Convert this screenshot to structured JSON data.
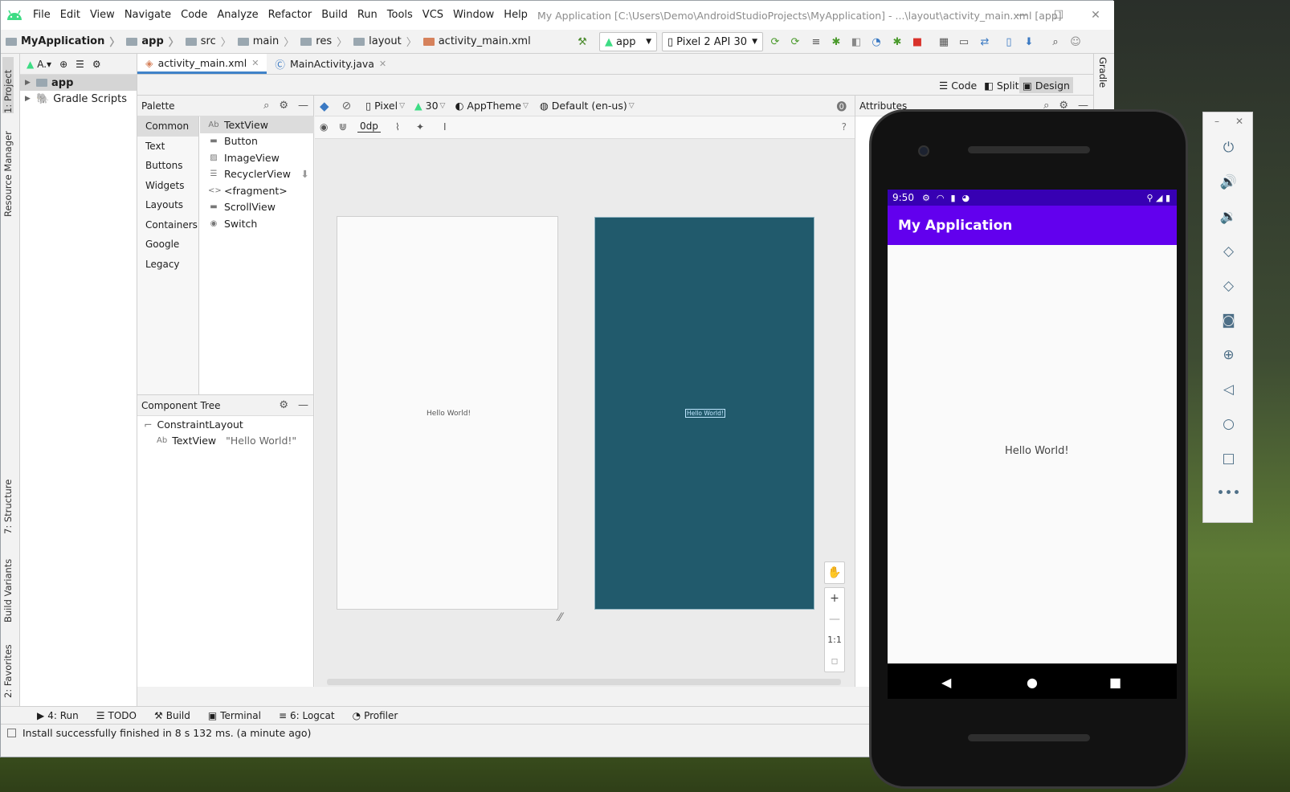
{
  "menu": [
    "File",
    "Edit",
    "View",
    "Navigate",
    "Code",
    "Analyze",
    "Refactor",
    "Build",
    "Run",
    "Tools",
    "VCS",
    "Window",
    "Help"
  ],
  "window_title": "My Application [C:\\Users\\Demo\\AndroidStudioProjects\\MyApplication] - ...\\layout\\activity_main.xml [app]",
  "breadcrumbs": [
    "MyApplication",
    "app",
    "src",
    "main",
    "res",
    "layout",
    "activity_main.xml"
  ],
  "run_config": "app",
  "device_selector": "Pixel 2 API 30",
  "left_stripe": {
    "project": "1: Project",
    "resource_manager": "Resource Manager",
    "structure": "7: Structure",
    "build_variants": "Build Variants",
    "favorites": "2: Favorites"
  },
  "project_tree": {
    "toolbar_label": "A.▾",
    "items": [
      "app",
      "Gradle Scripts"
    ]
  },
  "editor_tabs": [
    "activity_main.xml",
    "MainActivity.java"
  ],
  "view_modes": [
    "Code",
    "Split",
    "Design"
  ],
  "palette": {
    "title": "Palette",
    "categories": [
      "Common",
      "Text",
      "Buttons",
      "Widgets",
      "Layouts",
      "Containers",
      "Google",
      "Legacy"
    ],
    "widgets": [
      "TextView",
      "Button",
      "ImageView",
      "RecyclerView",
      "<fragment>",
      "ScrollView",
      "Switch"
    ]
  },
  "component_tree": {
    "title": "Component Tree",
    "root": "ConstraintLayout",
    "child": "TextView",
    "child_text": "\"Hello World!\""
  },
  "design_toolbar": {
    "device": "Pixel",
    "api": "30",
    "theme": "AppTheme",
    "locale": "Default (en-us)",
    "margin": "0dp"
  },
  "canvas": {
    "hello": "Hello World!",
    "zoom_1to1": "1:1"
  },
  "attributes": {
    "title": "Attributes"
  },
  "right_stripe": {
    "gradle": "Gradle"
  },
  "bottom_tools": [
    "4: Run",
    "TODO",
    "Build",
    "Terminal",
    "6: Logcat",
    "Profiler"
  ],
  "status_message": "Install successfully finished in 8 s 132 ms. (a minute ago)",
  "phone": {
    "time": "9:50",
    "app_title": "My Application",
    "hello": "Hello World!"
  },
  "colors": {
    "accent": "#4083c9",
    "app_bar": "#6200ee",
    "status_bar": "#3700b3",
    "blueprint": "#215a6c"
  }
}
